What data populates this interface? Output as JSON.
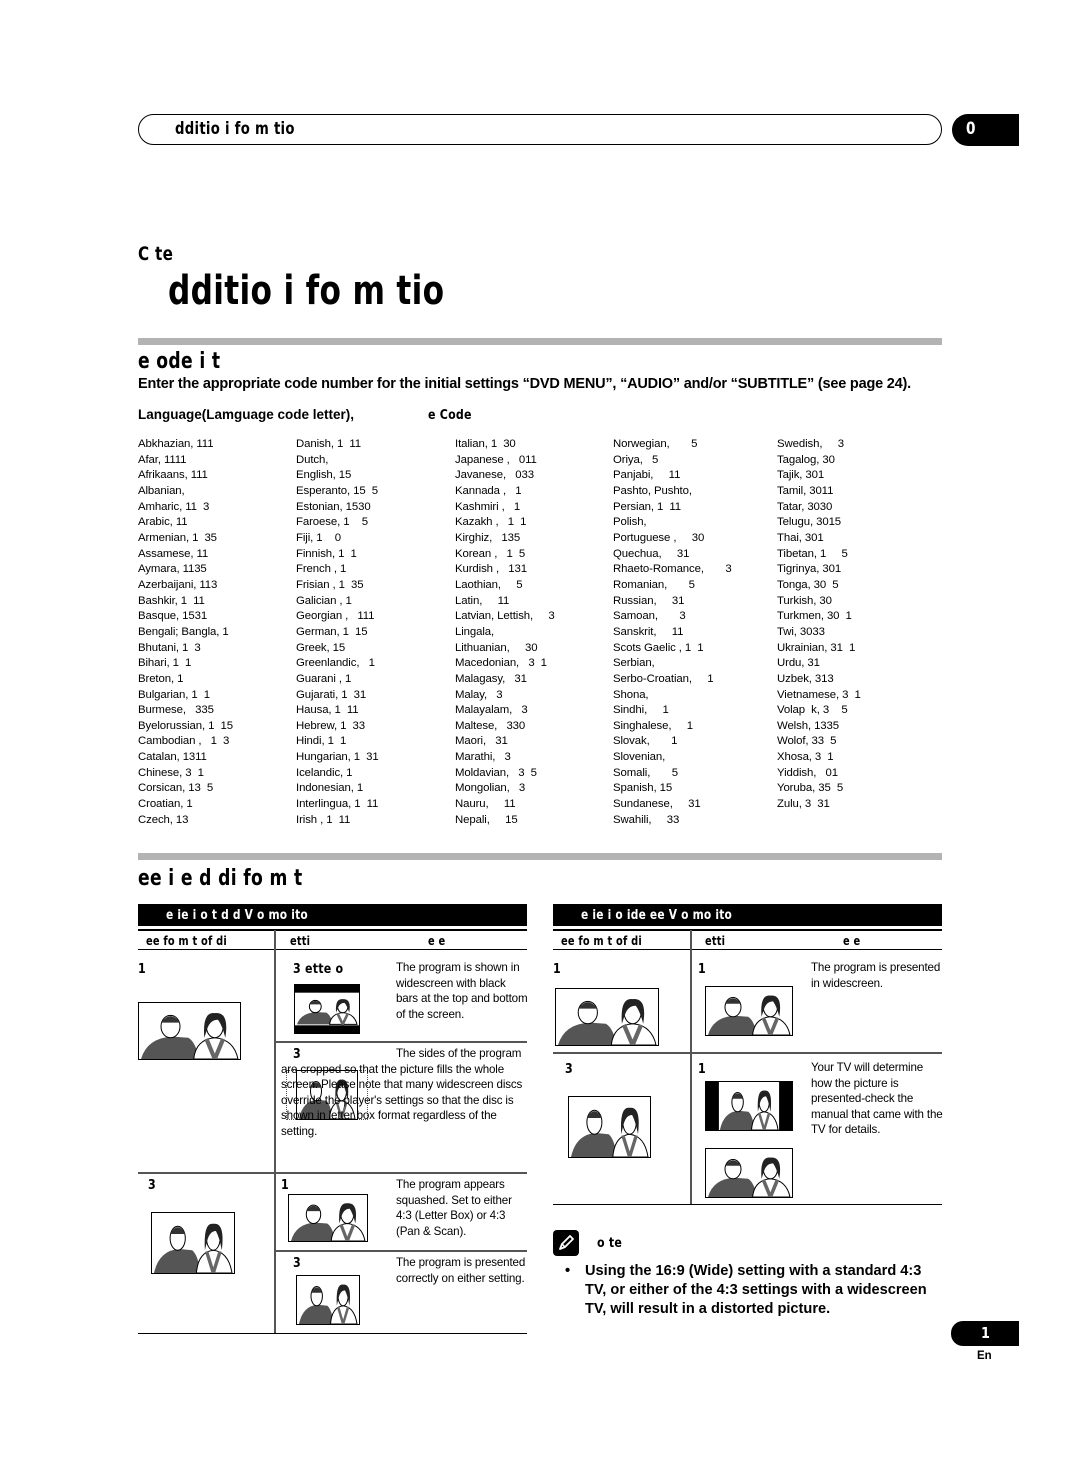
{
  "header": {
    "running_title": "dditio     i fo m tio",
    "chapter_tab": "0"
  },
  "chapter": {
    "label": "C        te",
    "title": "dditio       i  fo  m   tio"
  },
  "language_section": {
    "title": "e   ode  i t",
    "intro": "Enter the appropriate code number for the initial settings “DVD MENU”, “AUDIO” and/or “SUBTITLE” (see page 24).",
    "column_head_language": "Language(Lamguage code letter),",
    "column_head_code": "e Code",
    "columns": [
      [
        "Abkhazian, 111",
        "Afar, 1111",
        "Afrikaans, 111",
        "Albanian,",
        "Amharic, 11  3",
        "Arabic, 11",
        "Armenian, 1  35",
        "Assamese, 11",
        "Aymara, 1135",
        "Azerbaijani, 113",
        "Bashkir, 1  11",
        "Basque, 1531",
        "Bengali; Bangla, 1",
        "Bhutani, 1  3",
        "Bihari, 1  1",
        "Breton, 1",
        "Bulgarian, 1  1",
        "Burmese,   335",
        "Byelorussian, 1  15",
        "Cambodian ,   1  3",
        "Catalan, 1311",
        "Chinese, 3  1",
        "Corsican, 13  5",
        "Croatian, 1",
        "Czech, 13"
      ],
      [
        "Danish, 1  11",
        "Dutch,",
        "English, 15",
        "Esperanto, 15  5",
        "Estonian, 1530",
        "Faroese, 1    5",
        "Fiji, 1    0",
        "Finnish, 1  1",
        "French , 1",
        "Frisian , 1  35",
        "Galician , 1",
        "Georgian ,   111",
        "German, 1  15",
        "Greek, 15",
        "Greenlandic,   1",
        "Guarani , 1",
        "Gujarati, 1  31",
        "Hausa, 1  11",
        "Hebrew, 1  33",
        "Hindi, 1  1",
        "Hungarian, 1  31",
        "Icelandic, 1",
        "Indonesian, 1",
        "Interlingua, 1  11",
        "Irish , 1  11"
      ],
      [
        "Italian, 1  30",
        "Japanese ,   011",
        "Javanese,   033",
        "Kannada ,   1",
        "Kashmiri ,   1",
        "Kazakh ,   1  1",
        "Kirghiz,   135",
        "Korean ,   1  5",
        "Kurdish ,   131",
        "Laothian,     5",
        "Latin,     11",
        "Latvian, Lettish,     3",
        "Lingala,",
        "Lithuanian,     30",
        "Macedonian,   3  1",
        "Malagasy,   31",
        "Malay,   3",
        "Malayalam,   3",
        "Maltese,   330",
        "Maori,   31",
        "Marathi,   3",
        "Moldavian,   3  5",
        "Mongolian,   3",
        "Nauru,     11",
        "Nepali,     15"
      ],
      [
        "Norwegian,       5",
        "Oriya,   5",
        "Panjabi,     11",
        "Pashto, Pushto,",
        "Persian, 1  11",
        "Polish,",
        "Portuguese ,     30",
        "Quechua,     31",
        "Rhaeto-Romance,       3",
        "Romanian,       5",
        "Russian,     31",
        "Samoan,       3",
        "Sanskrit,     11",
        "Scots Gaelic , 1  1",
        "Serbian,",
        "Serbo-Croatian,     1",
        "Shona,",
        "Sindhi,     1",
        "Singhalese,     1",
        "Slovak,       1",
        "Slovenian,",
        "Somali,       5",
        "Spanish, 15",
        "Sundanese,     31",
        "Swahili,     33"
      ],
      [
        "Swedish,     3",
        "Tagalog, 30",
        "Tajik, 301",
        "Tamil, 3011",
        "Tatar, 3030",
        "Telugu, 3015",
        "Thai, 301",
        "Tibetan, 1     5",
        "Tigrinya, 301",
        "Tonga, 30  5",
        "Turkish, 30",
        "Turkmen, 30  1",
        "Twi, 3033",
        "Ukrainian, 31  1",
        "Urdu, 31",
        "Uzbek, 313",
        "Vietnamese, 3  1",
        "Volap  k, 3    5",
        "Welsh, 1335",
        "Wolof, 33  5",
        "Xhosa, 3  1",
        "Yiddish,   01",
        "Yoruba, 35  5",
        "Zulu, 3  31"
      ]
    ]
  },
  "screen_section": {
    "title": "ee   i e     d di   fo m t",
    "standard_table": {
      "title": "e   ie  i    o       t   d   d  V o  mo  ito",
      "col_format": "ee  fo m  t of di",
      "col_setting": "etti",
      "col_result": "e          e",
      "rows": [
        {
          "format": "1",
          "options": [
            {
              "setting": "3    ette      o",
              "description": "The program is shown in widescreen with black bars at the top and bottom of the screen.",
              "picture": "letterbox"
            },
            {
              "setting": "3",
              "description": "The sides of the program are cropped so that the picture fills the whole screen. Please note that many widescreen discs override the player's settings so that the disc is shown in letter box format regardless of the setting.",
              "picture": "pan-scan"
            }
          ]
        },
        {
          "format": "3",
          "options": [
            {
              "setting": "1",
              "description": "The program appears squashed. Set to either 4:3 (Letter Box) or 4:3 (Pan & Scan).",
              "picture": "squashed"
            },
            {
              "setting": "3",
              "description": "The program is presented correctly on either setting.",
              "picture": "standard"
            }
          ]
        }
      ]
    },
    "wide_table": {
      "title": "e   ie  i    o         ide   ee    V o  mo  ito",
      "col_format": "ee  fo m  t of di",
      "col_setting": "etti",
      "col_result": "e          e",
      "rows": [
        {
          "format": "1",
          "options": [
            {
              "setting": "1",
              "description": "The program is presented in widescreen.",
              "picture": "wide"
            }
          ]
        },
        {
          "format": "3",
          "options": [
            {
              "setting": "1",
              "description": "Your TV will determine how the picture is presented-check the manual that came with the TV for details.",
              "picture": "pillarbox-or-stretched"
            }
          ]
        }
      ]
    },
    "note": {
      "label": "o te",
      "text": "Using the 16:9 (Wide) setting with a standard 4:3 TV, or either of the 4:3 settings with a widescreen TV, will result in a distorted picture."
    }
  },
  "footer": {
    "page_number": "1",
    "language": "En"
  },
  "colors": {
    "section_bar": "#b3b3b3",
    "ink": "#000000"
  }
}
